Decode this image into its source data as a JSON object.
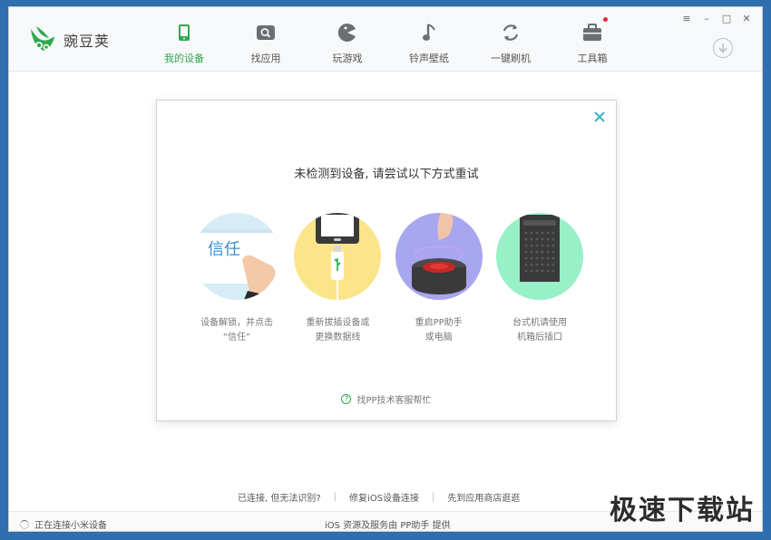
{
  "app": {
    "name": "豌豆荚"
  },
  "nav": [
    {
      "label": "我的设备",
      "icon": "phone-icon",
      "active": true
    },
    {
      "label": "找应用",
      "icon": "search-icon",
      "active": false
    },
    {
      "label": "玩游戏",
      "icon": "game-icon",
      "active": false
    },
    {
      "label": "铃声壁纸",
      "icon": "music-note-icon",
      "active": false
    },
    {
      "label": "一键刷机",
      "icon": "refresh-icon",
      "active": false
    },
    {
      "label": "工具箱",
      "icon": "toolbox-icon",
      "active": false,
      "badge": true
    }
  ],
  "window_controls": {
    "menu": "≡",
    "minimize": "–",
    "maximize": "□",
    "close": "✕"
  },
  "dialog": {
    "title": "未检测到设备, 请尝试以下方式重试",
    "steps": [
      {
        "text": "设备解锁，并点击\n“信任”",
        "illustration_text": "信任",
        "icon": "trust-prompt-icon",
        "bg": "#d6ecf7"
      },
      {
        "text": "重新拔插设备或\n更换数据线",
        "icon": "usb-cable-icon",
        "bg": "#fbe58a"
      },
      {
        "text": "重启PP助手\n或电脑",
        "icon": "restart-button-icon",
        "bg": "#a7a6ef"
      },
      {
        "text": "台式机请使用\n机箱后插口",
        "icon": "desktop-case-icon",
        "bg": "#98f0c6"
      }
    ],
    "help_link": "找PP技术客服帮忙"
  },
  "footer_links": [
    "已连接, 但无法识别?",
    "修复iOS设备连接",
    "先到应用商店逛逛"
  ],
  "status": {
    "left": "正在连接小米设备",
    "center": "iOS 资源及服务由 PP助手 提供"
  },
  "watermark": "极速下载站",
  "colors": {
    "accent": "#2fa84f",
    "close": "#3bb3c8",
    "badge": "#e62b3c"
  }
}
